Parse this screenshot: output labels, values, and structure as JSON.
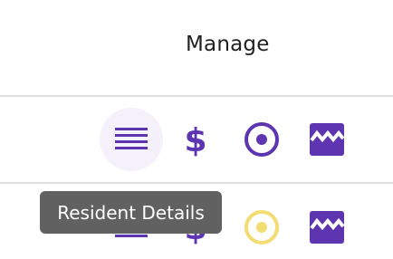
{
  "header": {
    "title": "Manage"
  },
  "rows": [
    {
      "icons": [
        {
          "name": "list-icon",
          "color": "#5e35b1"
        },
        {
          "name": "dollar-icon",
          "color": "#5e35b1"
        },
        {
          "name": "radio-target-icon",
          "color": "#5e35b1"
        },
        {
          "name": "image-icon",
          "color": "#5e35b1"
        }
      ]
    },
    {
      "icons": [
        {
          "name": "list-icon",
          "color": "#5e35b1"
        },
        {
          "name": "dollar-icon",
          "color": "#5e35b1"
        },
        {
          "name": "radio-target-icon",
          "color": "#f3dc72"
        },
        {
          "name": "image-icon",
          "color": "#5e35b1"
        }
      ]
    }
  ],
  "tooltip": {
    "text": "Resident Details"
  },
  "colors": {
    "accent": "#5e35b1",
    "warning": "#f3dc72",
    "tooltip_bg": "#616161",
    "divider": "#e0e0e0"
  }
}
